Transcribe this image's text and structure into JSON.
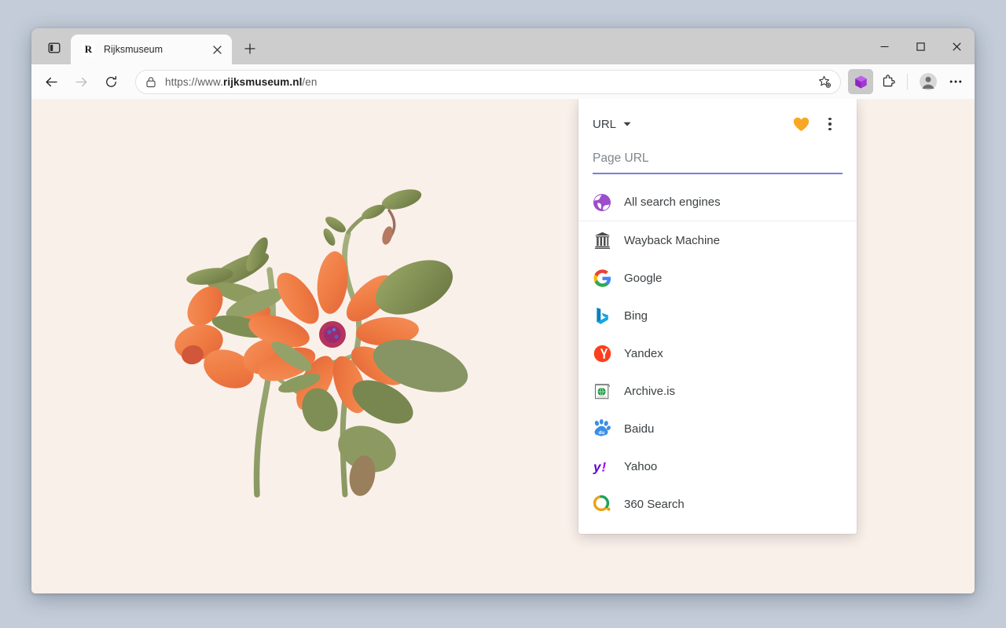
{
  "window": {
    "controls": {
      "minimize_label": "Minimize",
      "maximize_label": "Maximize",
      "close_label": "Close"
    },
    "sidebar_toggle_label": "Tab actions"
  },
  "tabs": {
    "new_tab_label": "New tab",
    "items": [
      {
        "favicon_letter": "R",
        "title": "Rijksmuseum",
        "close_label": "Close tab",
        "active": true
      }
    ]
  },
  "navbar": {
    "back_label": "Back",
    "forward_label": "Forward",
    "reload_label": "Refresh",
    "lock_icon": "lock-icon",
    "url_prefix": "https://www.",
    "url_domain": "rijksmuseum.nl",
    "url_path": "/en",
    "url_full": "https://www.rijksmuseum.nl/en",
    "add_favorite_label": "Add this page to favorites",
    "extension_cube_label": "Search engine switcher",
    "extensions_label": "Extensions",
    "profile_label": "Profile",
    "settings_label": "Settings and more"
  },
  "page": {
    "background_color": "#faf0ea",
    "artwork_name": "botanical-flower-illustration",
    "artwork_alt": "Watercolor botanical illustration of orange flowers with green leaves"
  },
  "popup": {
    "mode_label": "URL",
    "mode_caret": "chevron-down-icon",
    "favorite_icon": "heart-icon",
    "favorite_color": "#f9a825",
    "menu_icon": "kebab-menu-icon",
    "accent_color": "#7b7fe0",
    "url_input": {
      "placeholder": "Page URL",
      "value": ""
    },
    "engines": [
      {
        "name": "All search engines",
        "icon": "globe-icon",
        "color": "#9c4dcc",
        "divider": true
      },
      {
        "name": "Wayback Machine",
        "icon": "archive-icon",
        "color": "#4a4a4a",
        "divider": false
      },
      {
        "name": "Google",
        "icon": "google-icon",
        "color": "#4285f4",
        "divider": false
      },
      {
        "name": "Bing",
        "icon": "bing-icon",
        "color": "#00a4ef",
        "divider": false
      },
      {
        "name": "Yandex",
        "icon": "yandex-icon",
        "color": "#fc3f1d",
        "divider": false
      },
      {
        "name": "Archive.is",
        "icon": "archive-is-icon",
        "color": "#1a9641",
        "divider": false
      },
      {
        "name": "Baidu",
        "icon": "baidu-icon",
        "color": "#2932e1",
        "divider": false
      },
      {
        "name": "Yahoo",
        "icon": "yahoo-icon",
        "color": "#6001d2",
        "divider": false
      },
      {
        "name": "360 Search",
        "icon": "threesixty-icon",
        "color": "#19a562",
        "divider": false
      }
    ]
  }
}
